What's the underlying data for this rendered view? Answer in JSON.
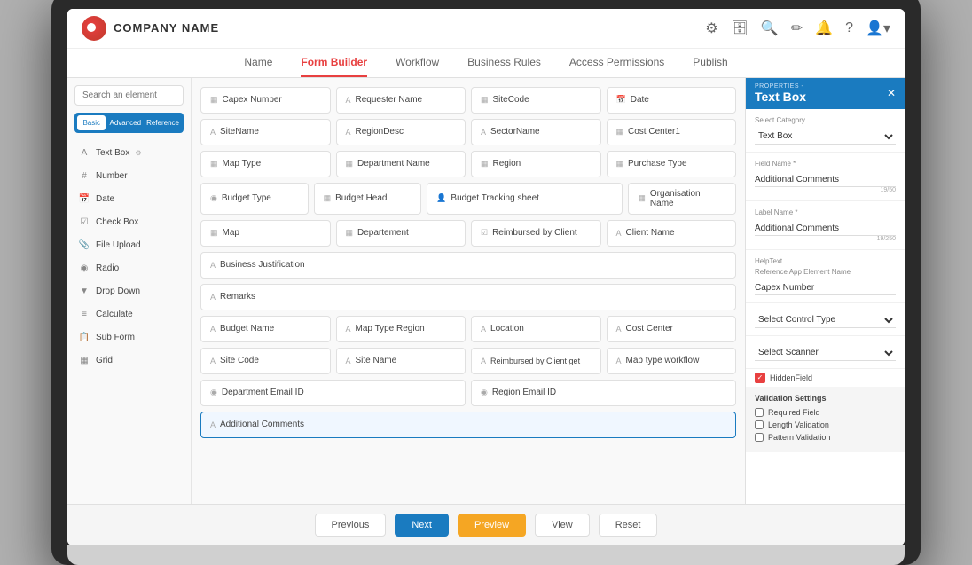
{
  "company": {
    "name": "COMPANY NAME"
  },
  "nav": {
    "tabs": [
      {
        "label": "Name",
        "active": false
      },
      {
        "label": "Form Builder",
        "active": true
      },
      {
        "label": "Workflow",
        "active": false
      },
      {
        "label": "Business Rules",
        "active": false
      },
      {
        "label": "Access Permissions",
        "active": false
      },
      {
        "label": "Publish",
        "active": false
      }
    ]
  },
  "topbar_icons": [
    "⚙",
    "🗄",
    "🔍",
    "✏",
    "🔔",
    "?",
    "👤"
  ],
  "sidebar": {
    "search_placeholder": "Search an element",
    "tabs": [
      {
        "label": "Basic",
        "active": true
      },
      {
        "label": "Advanced",
        "active": false
      },
      {
        "label": "Reference",
        "active": false
      }
    ],
    "items": [
      {
        "icon": "A",
        "label": "Text Box"
      },
      {
        "icon": "#",
        "label": "Number"
      },
      {
        "icon": "📅",
        "label": "Date"
      },
      {
        "icon": "☑",
        "label": "Check Box"
      },
      {
        "icon": "👤",
        "label": "File Upload"
      },
      {
        "icon": "◉",
        "label": "Radio"
      },
      {
        "icon": "▼",
        "label": "Drop Down"
      },
      {
        "icon": "=",
        "label": "Calculate"
      },
      {
        "icon": "📋",
        "label": "Sub Form"
      },
      {
        "icon": "▦",
        "label": "Grid"
      }
    ]
  },
  "form_fields": [
    [
      {
        "label": "Capex Number",
        "icon": "▦",
        "flex": 1
      },
      {
        "label": "Requester Name",
        "icon": "A",
        "flex": 1
      },
      {
        "label": "SiteCode",
        "icon": "▦",
        "flex": 1
      },
      {
        "label": "Date",
        "icon": "📅",
        "flex": 1
      }
    ],
    [
      {
        "label": "SiteName",
        "icon": "A",
        "flex": 1
      },
      {
        "label": "RegionDesc",
        "icon": "A",
        "flex": 1
      },
      {
        "label": "SectorName",
        "icon": "A",
        "flex": 1
      },
      {
        "label": "Cost Center1",
        "icon": "▦",
        "flex": 1
      }
    ],
    [
      {
        "label": "Map Type",
        "icon": "▦",
        "flex": 1
      },
      {
        "label": "Department Name",
        "icon": "▦",
        "flex": 1
      },
      {
        "label": "Region",
        "icon": "▦",
        "flex": 1
      },
      {
        "label": "Purchase Type",
        "icon": "▦",
        "flex": 1
      }
    ],
    [
      {
        "label": "Budget Type",
        "icon": "◉",
        "flex": 1
      },
      {
        "label": "Budget Head",
        "icon": "▦",
        "flex": 1
      },
      {
        "label": "Budget Tracking sheet",
        "icon": "👤",
        "flex": 2
      },
      {
        "label": "Organisation Name",
        "icon": "▦",
        "flex": 1
      }
    ],
    [
      {
        "label": "Map",
        "icon": "▦",
        "flex": 1
      },
      {
        "label": "Departement",
        "icon": "▦",
        "flex": 1
      },
      {
        "label": "Reimbursed by Client",
        "icon": "☑",
        "flex": 1
      },
      {
        "label": "Client Name",
        "icon": "A",
        "flex": 1
      }
    ],
    [
      {
        "label": "Business Justification",
        "icon": "A",
        "flex": 4
      }
    ],
    [
      {
        "label": "Remarks",
        "icon": "A",
        "flex": 4
      }
    ],
    [
      {
        "label": "Budget Name",
        "icon": "A",
        "flex": 1
      },
      {
        "label": "Map Type Region",
        "icon": "A",
        "flex": 1
      },
      {
        "label": "Location",
        "icon": "A",
        "flex": 1
      },
      {
        "label": "Cost Center",
        "icon": "A",
        "flex": 1
      }
    ],
    [
      {
        "label": "Site Code",
        "icon": "A",
        "flex": 1
      },
      {
        "label": "Site Name",
        "icon": "A",
        "flex": 1
      },
      {
        "label": "Reimbursed by Client get",
        "icon": "A",
        "flex": 1
      },
      {
        "label": "Map type workflow",
        "icon": "A",
        "flex": 1
      }
    ],
    [
      {
        "label": "Department Email ID",
        "icon": "◉",
        "flex": 2
      },
      {
        "label": "Region Email ID",
        "icon": "◉",
        "flex": 2
      }
    ],
    [
      {
        "label": "Additional Comments",
        "icon": "A",
        "flex": 4,
        "active": true
      }
    ]
  ],
  "properties": {
    "title_small": "PROPERTIES -",
    "title_large": "Text Box",
    "select_category_label": "Select Category",
    "select_category_value": "Text Box",
    "field_name_label": "Field Name *",
    "field_name_value": "Additional Comments",
    "field_name_count": "19/50",
    "label_name_label": "Label Name *",
    "label_name_value": "Additional Comments",
    "label_name_count": "19/250",
    "helptext_label": "HelpText",
    "ref_element_label": "Reference App Element Name",
    "ref_element_value": "Capex Number",
    "control_type_label": "Select Control Type",
    "scanner_label": "Select Scanner",
    "hidden_field_label": "HiddenField",
    "hidden_field_checked": true,
    "validation_title": "Validation Settings",
    "validations": [
      {
        "label": "Required Field",
        "checked": false
      },
      {
        "label": "Length Validation",
        "checked": false
      },
      {
        "label": "Pattern Validation",
        "checked": false
      }
    ]
  },
  "toolbar": {
    "previous_label": "Previous",
    "next_label": "Next",
    "preview_label": "Preview",
    "view_label": "View",
    "reset_label": "Reset"
  }
}
